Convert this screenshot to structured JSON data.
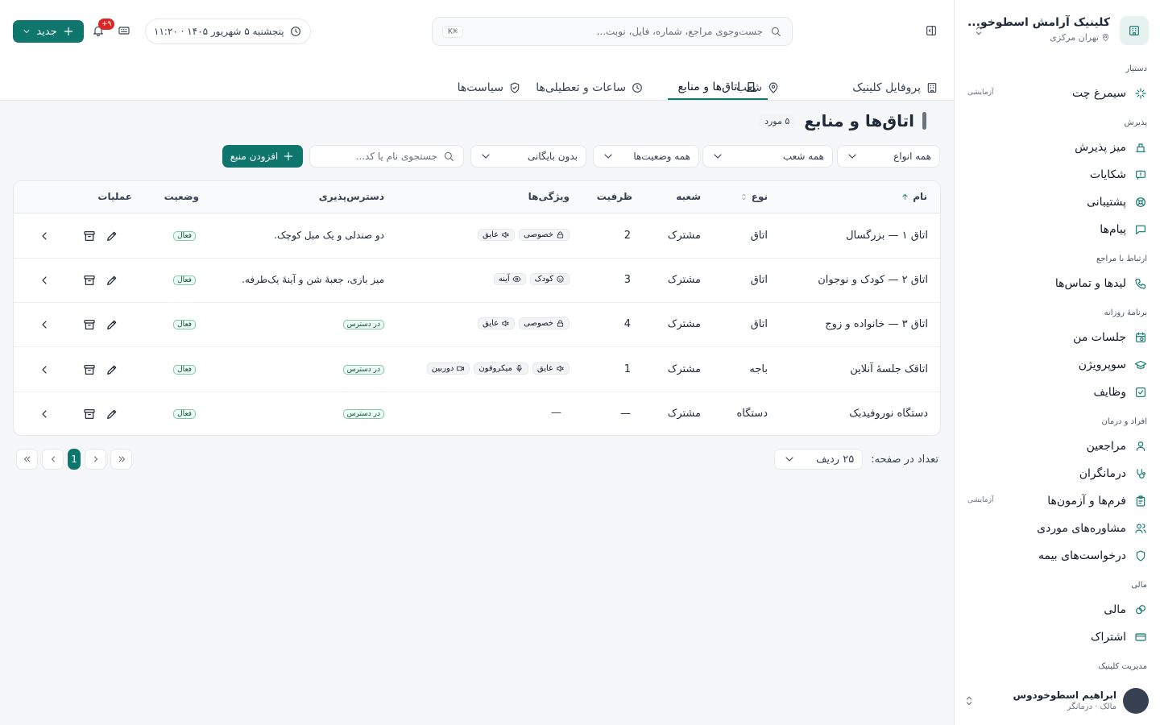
{
  "sidebar": {
    "clinic_name": "کلینیک آرامش اسطوخو...",
    "clinic_location": "تهران مرکزی",
    "sections": [
      {
        "title": "دستیار",
        "items": [
          {
            "label": "سیمرغ چت",
            "icon": "sparkle-icon",
            "tag": "آزمایشی"
          }
        ]
      },
      {
        "title": "پذیرش",
        "items": [
          {
            "label": "میز پذیرش",
            "icon": "desk-bell-icon"
          },
          {
            "label": "شکایات",
            "icon": "alert-message-icon"
          },
          {
            "label": "پشتیبانی",
            "icon": "lifebuoy-icon"
          },
          {
            "label": "پیام‌ها",
            "icon": "message-icon"
          }
        ]
      },
      {
        "title": "ارتباط با مراجع",
        "items": [
          {
            "label": "لیدها و تماس‌ها",
            "icon": "phone-icon"
          }
        ]
      },
      {
        "title": "برنامهٔ روزانه",
        "items": [
          {
            "label": "جلسات من",
            "icon": "calendar-clock-icon"
          },
          {
            "label": "سوپرویژن",
            "icon": "graduation-cap-icon"
          },
          {
            "label": "وظایف",
            "icon": "checkbox-icon"
          }
        ]
      },
      {
        "title": "افراد و درمان",
        "items": [
          {
            "label": "مراجعین",
            "icon": "user-icon"
          },
          {
            "label": "درمانگران",
            "icon": "stethoscope-icon"
          },
          {
            "label": "فرم‌ها و آزمون‌ها",
            "icon": "clipboard-icon",
            "tag": "آزمایشی"
          },
          {
            "label": "مشاوره‌های موردی",
            "icon": "users-icon"
          },
          {
            "label": "درخواست‌های بیمه",
            "icon": "shield-icon"
          }
        ]
      },
      {
        "title": "مالی",
        "items": [
          {
            "label": "مالی",
            "icon": "coins-icon"
          },
          {
            "label": "اشتراک",
            "icon": "credit-card-icon"
          }
        ]
      },
      {
        "title": "مدیریت کلینیک",
        "items": []
      }
    ],
    "user": {
      "name": "ابراهیم اسطوخودوس",
      "role": "مالک · درمانگر"
    }
  },
  "topbar": {
    "search_placeholder": "جست‌وجوی مراجع، شماره، فایل، نوبت...",
    "search_kbd": "⌘K",
    "date": "پنجشنبه ۵ شهریور ۱۴۰۵ · ۱۱:۲۰",
    "notif_count": "۹+",
    "new_label": "جدید"
  },
  "tabs": [
    {
      "label": "پروفایل کلینیک",
      "icon": "building-icon"
    },
    {
      "label": "شعب",
      "icon": "map-pin-icon"
    },
    {
      "label": "اتاق‌ها و منابع",
      "icon": "door-icon",
      "active": true
    },
    {
      "label": "ساعات و تعطیلی‌ها",
      "icon": "clock-icon"
    },
    {
      "label": "سیاست‌ها",
      "icon": "shield-check-icon"
    }
  ],
  "page": {
    "title": "اتاق‌ها و منابع",
    "count": "۵ مورد",
    "filters": {
      "type": "همه انواع",
      "branch": "همه شعب",
      "status": "همه وضعیت‌ها",
      "archive": "بدون بایگانی",
      "search_placeholder": "جستجوی نام یا کد..."
    },
    "add_label": "افزودن منبع"
  },
  "table": {
    "headers": {
      "name": "نام",
      "type": "نوع",
      "branch": "شعبه",
      "capacity": "ظرفیت",
      "features": "ویژگی‌ها",
      "access": "دسترس‌پذیری",
      "status": "وضعیت",
      "actions": "عملیات"
    },
    "rows": [
      {
        "name": "اتاق ۱ — بزرگسال",
        "type": "اتاق",
        "branch": "مشترک",
        "capacity": "2",
        "features": [
          {
            "label": "خصوصی",
            "icon": "lock-icon"
          },
          {
            "label": "عایق",
            "icon": "sound-off-icon"
          }
        ],
        "access": "دو صندلی و یک مبل کوچک.",
        "access_badge": false,
        "status": "فعال"
      },
      {
        "name": "اتاق ۲ — کودک و نوجوان",
        "type": "اتاق",
        "branch": "مشترک",
        "capacity": "3",
        "features": [
          {
            "label": "کودک",
            "icon": "smile-icon"
          },
          {
            "label": "آینه",
            "icon": "eye-icon"
          }
        ],
        "access": "میز بازی، جعبهٔ شن و آینهٔ یک‌طرفه.",
        "access_badge": false,
        "status": "فعال"
      },
      {
        "name": "اتاق ۳ — خانواده و زوج",
        "type": "اتاق",
        "branch": "مشترک",
        "capacity": "4",
        "features": [
          {
            "label": "خصوصی",
            "icon": "lock-icon"
          },
          {
            "label": "عایق",
            "icon": "sound-off-icon"
          }
        ],
        "access": "در دسترس",
        "access_badge": true,
        "status": "فعال"
      },
      {
        "name": "اتاقک جلسهٔ آنلاین",
        "type": "باجه",
        "branch": "مشترک",
        "capacity": "1",
        "features": [
          {
            "label": "عایق",
            "icon": "sound-off-icon"
          },
          {
            "label": "میکروفون",
            "icon": "mic-icon"
          },
          {
            "label": "دوربین",
            "icon": "camera-icon"
          }
        ],
        "access": "در دسترس",
        "access_badge": true,
        "status": "فعال"
      },
      {
        "name": "دستگاه نوروفیدبک",
        "type": "دستگاه",
        "branch": "مشترک",
        "capacity": "—",
        "features": [],
        "features_empty": "—",
        "access": "در دسترس",
        "access_badge": true,
        "status": "فعال"
      }
    ]
  },
  "pagination": {
    "per_page_label": "تعداد در صفحه:",
    "per_page_value": "۲۵ ردیف",
    "current_page": "1"
  },
  "colors": {
    "accent": "#0f766e",
    "status_active": "#0f5132",
    "danger": "#dc2626"
  }
}
